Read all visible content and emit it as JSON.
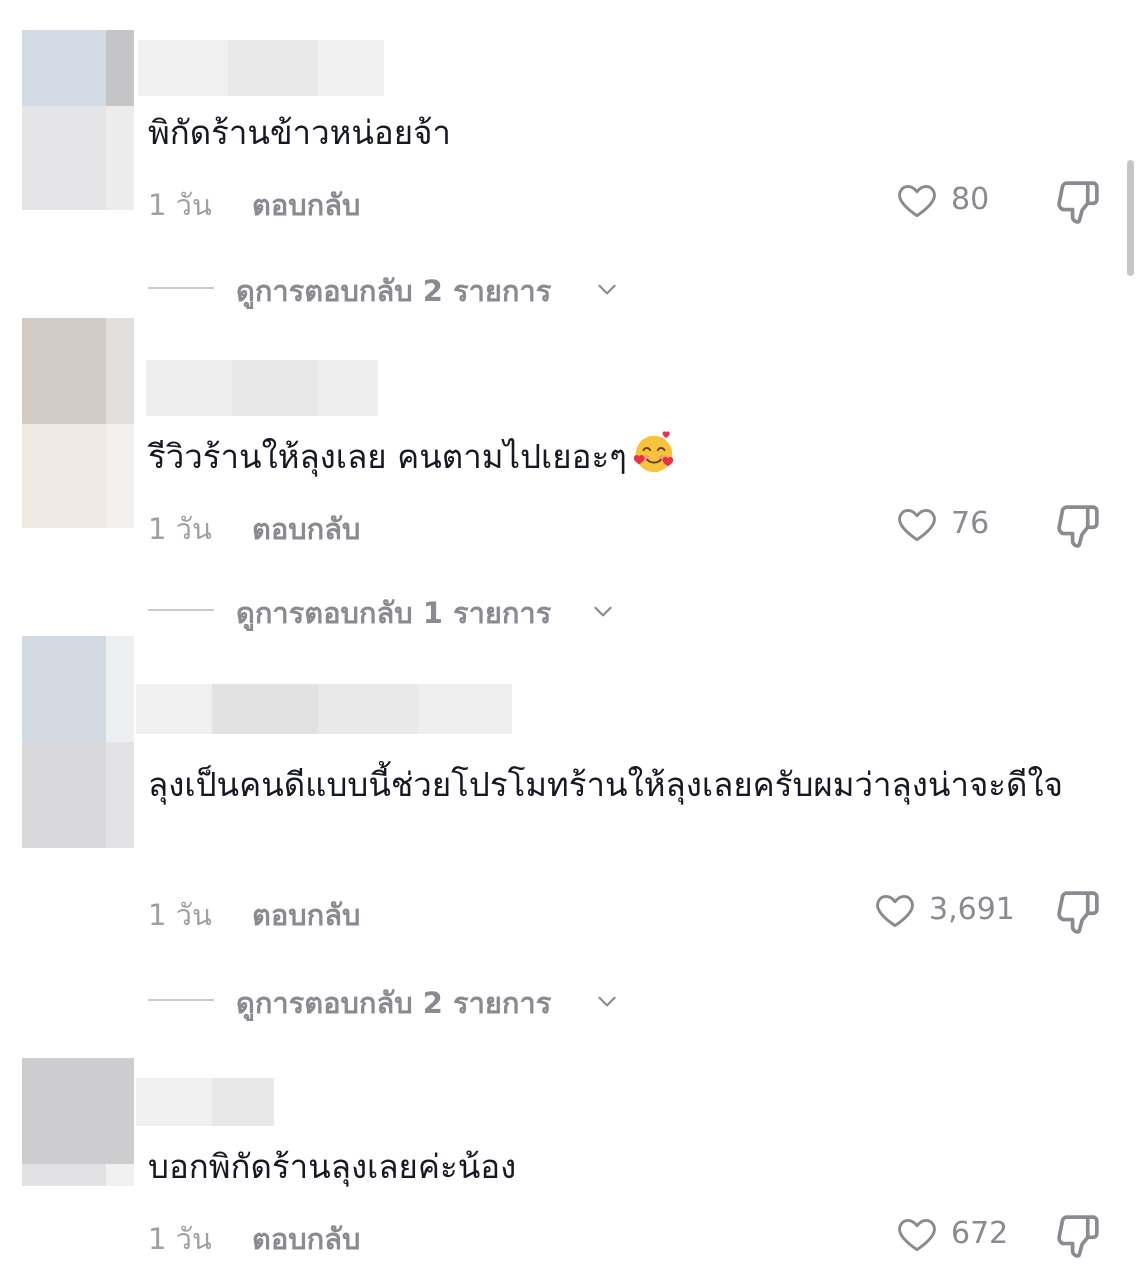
{
  "comments": [
    {
      "text": "พิกัดร้านข้าวหน่อยจ้า",
      "time": "1 วัน",
      "reply_label": "ตอบกลับ",
      "likes": "80",
      "view_replies": "ดูการตอบกลับ 2 รายการ"
    },
    {
      "text": "รีวิวร้านให้ลุงเลย คนตามไปเยอะๆ",
      "emoji": "smiling-face-with-hearts-icon",
      "time": "1 วัน",
      "reply_label": "ตอบกลับ",
      "likes": "76",
      "view_replies": "ดูการตอบกลับ 1 รายการ"
    },
    {
      "text": "ลุงเป็นคนดีแบบนี้ช่วยโปรโมทร้านให้ลุงเลยครับผมว่าลุงน่าจะดีใจ",
      "time": "1 วัน",
      "reply_label": "ตอบกลับ",
      "likes": "3,691",
      "view_replies": "ดูการตอบกลับ 2 รายการ"
    },
    {
      "text": "บอกพิกัดร้านลุงเลยค่ะน้อง",
      "time": "1 วัน",
      "reply_label": "ตอบกลับ",
      "likes": "672"
    }
  ],
  "icons": {
    "like": "heart-outline-icon",
    "dislike": "thumbs-down-outline-icon",
    "expand": "chevron-down-icon"
  },
  "colors": {
    "text": "#161823",
    "secondary_text": "#8a8b91",
    "time_text": "#a0a0a4"
  }
}
